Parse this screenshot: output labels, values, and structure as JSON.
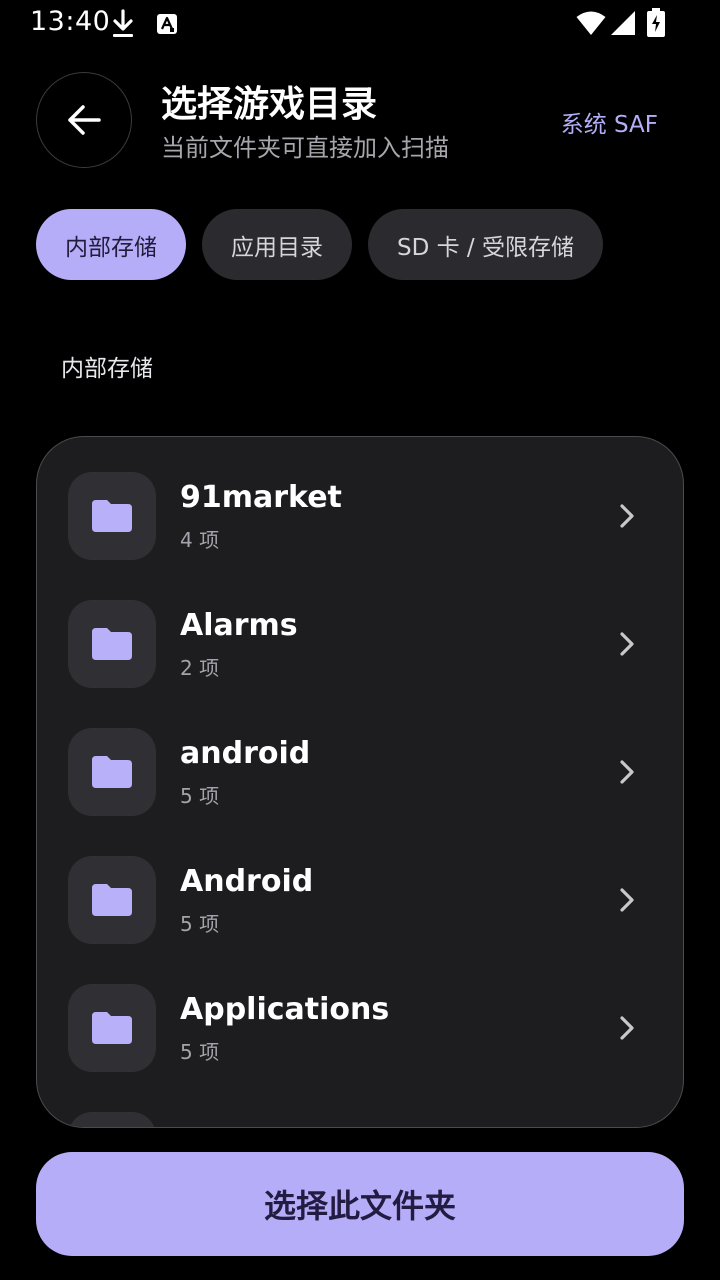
{
  "status_bar": {
    "time": "13:40",
    "icons": [
      "download-icon",
      "a-badge-icon",
      "wifi-icon",
      "signal-icon",
      "battery-charging-icon"
    ]
  },
  "header": {
    "back_icon": "arrow-left-icon",
    "title": "选择游戏目录",
    "subtitle": "当前文件夹可直接加入扫描",
    "saf_label": "系统 SAF"
  },
  "tabs": [
    {
      "label": "内部存储",
      "active": true
    },
    {
      "label": "应用目录",
      "active": false
    },
    {
      "label": "SD 卡 / 受限存储",
      "active": false
    }
  ],
  "section_label": "内部存储",
  "folders": [
    {
      "name": "91market",
      "count": "4 项"
    },
    {
      "name": "Alarms",
      "count": "2 项"
    },
    {
      "name": "android",
      "count": "5 项"
    },
    {
      "name": "Android",
      "count": "5 项"
    },
    {
      "name": "Applications",
      "count": "5 项"
    }
  ],
  "select_button_label": "选择此文件夹",
  "colors": {
    "accent": "#b6adf8",
    "accent_text": "#b3aef7",
    "card_bg": "#1d1d20",
    "tab_bg": "#2b2b2f",
    "background": "#000000"
  }
}
